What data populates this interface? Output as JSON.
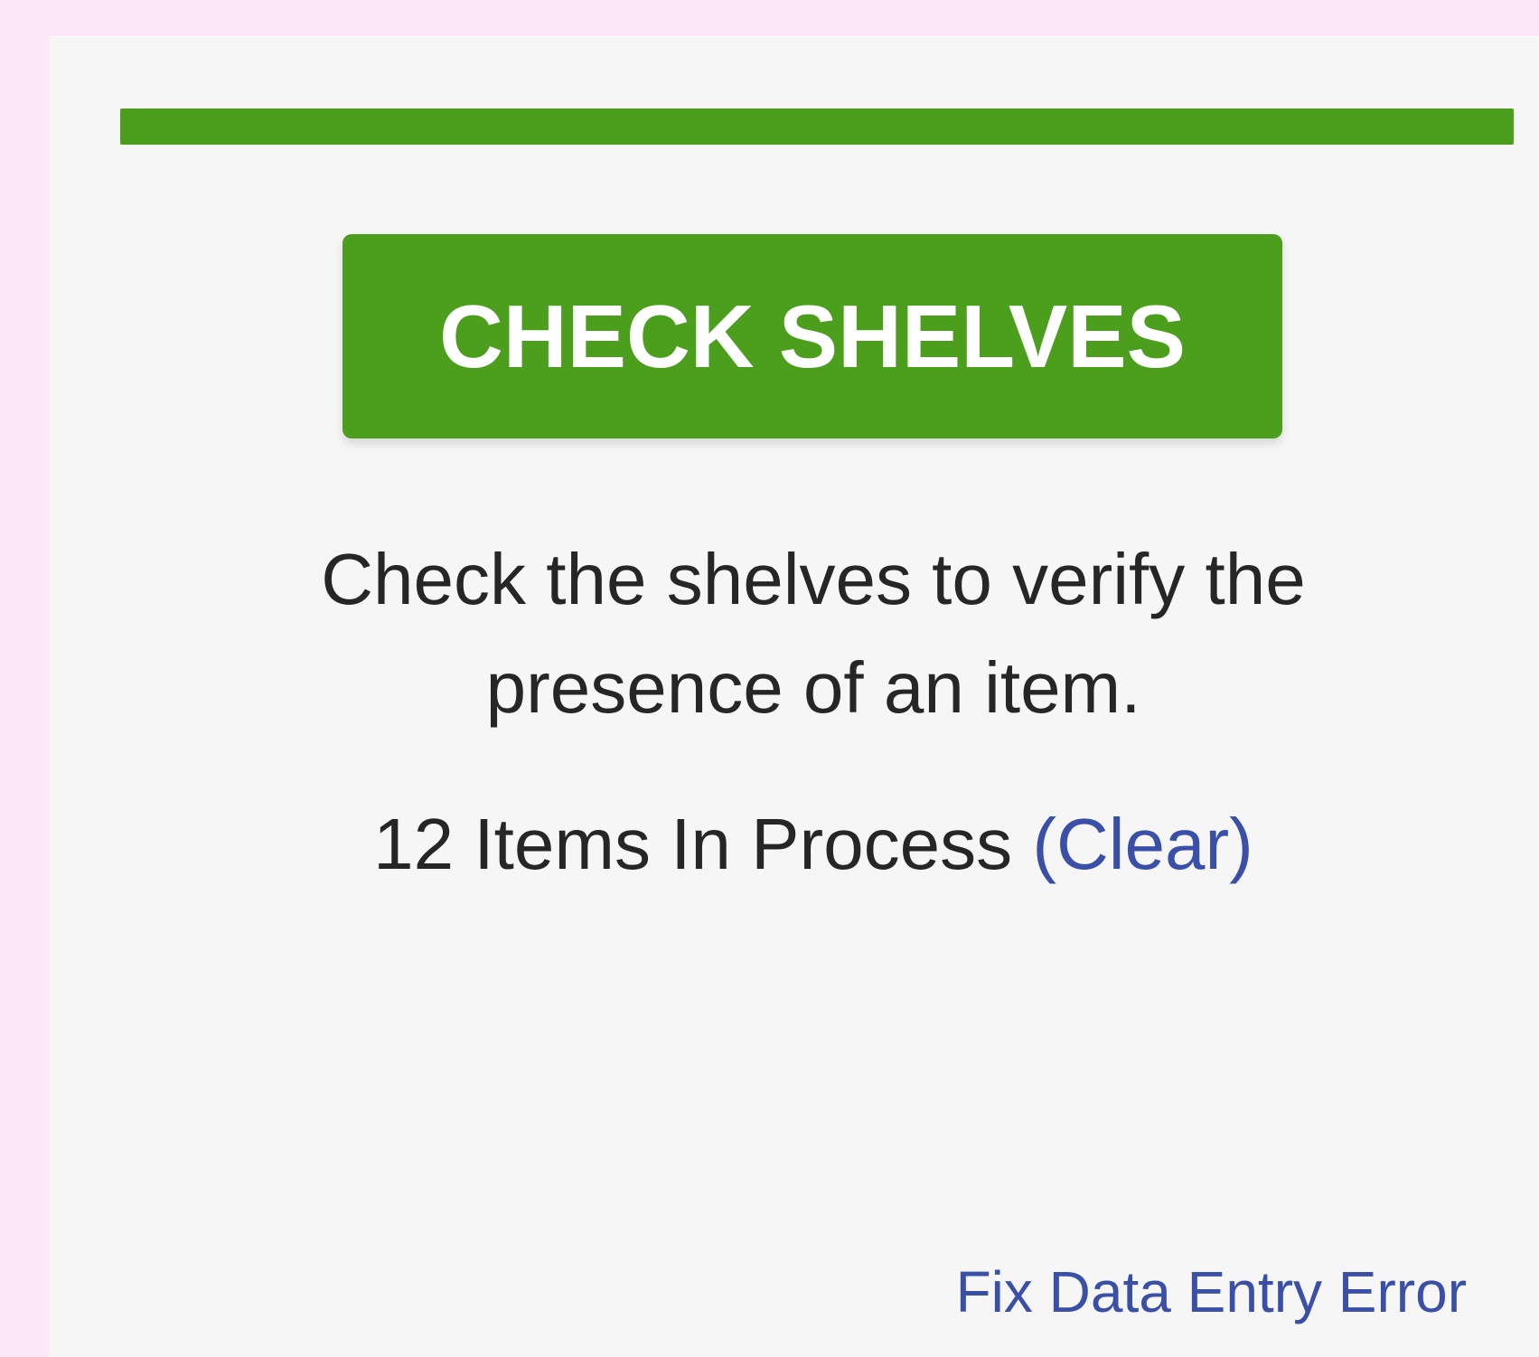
{
  "progress": {
    "fraction": 1.0,
    "color": "#4b9f1c"
  },
  "main": {
    "button_label": "CHECK SHELVES",
    "description": "Check the shelves to verify the presence of an item.",
    "items_count_text": "12 Items In Process",
    "clear_link": "(Clear)"
  },
  "footer": {
    "fix_link": "Fix Data Entry Error"
  },
  "colors": {
    "page_background": "#fde8f7",
    "panel_background": "#f6f6f6",
    "accent_green": "#4b9f1c",
    "link_blue": "#3a4fa8",
    "text": "#262626"
  }
}
